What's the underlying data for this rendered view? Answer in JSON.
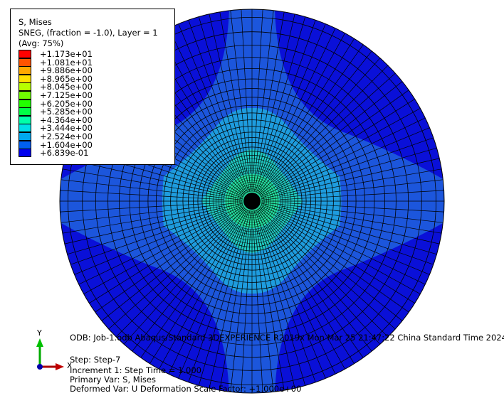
{
  "legend": {
    "title": "S, Mises",
    "line2": "SNEG, (fraction = -1.0), Layer = 1",
    "line3": "(Avg: 75%)",
    "entries": [
      {
        "color": "#ff0000",
        "label": "+1.173e+01"
      },
      {
        "color": "#ff5400",
        "label": "+1.081e+01"
      },
      {
        "color": "#ffa800",
        "label": "+9.886e+00"
      },
      {
        "color": "#ffe000",
        "label": "+8.965e+00"
      },
      {
        "color": "#b8ff00",
        "label": "+8.045e+00"
      },
      {
        "color": "#70ff00",
        "label": "+7.125e+00"
      },
      {
        "color": "#22ff00",
        "label": "+6.205e+00"
      },
      {
        "color": "#00ff46",
        "label": "+5.285e+00"
      },
      {
        "color": "#00ffaa",
        "label": "+4.364e+00"
      },
      {
        "color": "#00e0e8",
        "label": "+3.444e+00"
      },
      {
        "color": "#00a8ee",
        "label": "+2.524e+00"
      },
      {
        "color": "#0060f0",
        "label": "+1.604e+00"
      },
      {
        "color": "#0000ee",
        "label": "+6.839e-01"
      }
    ]
  },
  "info": {
    "odb": "ODB: Job-1.odb    Abaqus/Standard 3DEXPERIENCE R2019x    Mon Mar 25 21:47:22 China Standard Time 2024",
    "step": "Step: Step-7",
    "increment": "Increment      1: Step Time =    1.000",
    "primary": "Primary Var: S, Mises",
    "deformed": "Deformed Var: U   Deformation Scale Factor: +1.000e+00"
  },
  "triad": {
    "y_label": "Y",
    "x_label": "X"
  },
  "colors": {
    "band_outer": "#0a10d8",
    "band_2": "#1c56dc",
    "band_3": "#1e9cde",
    "band_4": "#20c8c0",
    "band_5": "#24e0a0",
    "mesh": "#000000"
  }
}
